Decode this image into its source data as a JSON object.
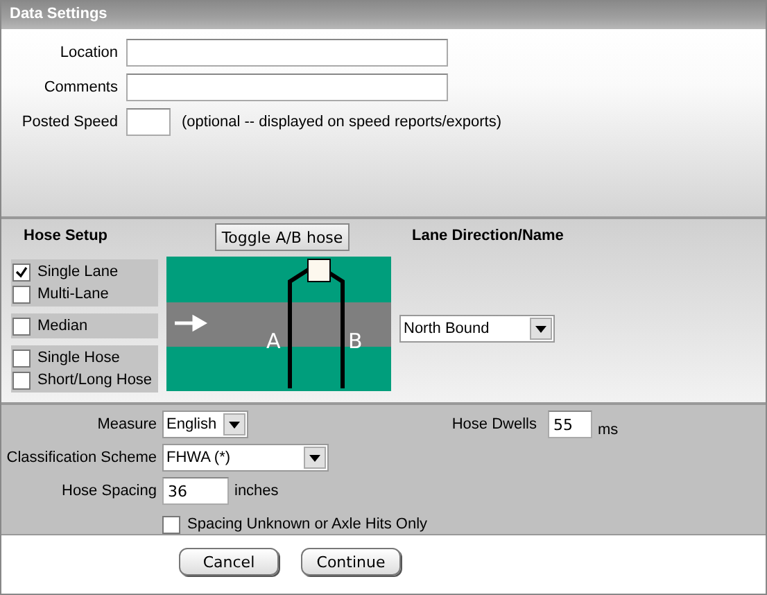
{
  "window": {
    "title": "Data Settings"
  },
  "fields": [
    {
      "label": "Location",
      "kind": "wide"
    },
    {
      "label": "Comments",
      "kind": "wide"
    },
    {
      "label": "Posted Speed",
      "kind": "short",
      "note": "(optional -- displayed on speed reports/exports)"
    }
  ],
  "hose_setup": {
    "title": "Hose Setup",
    "toggle_button": "Toggle A/B hose",
    "lane_title": "Lane Direction/Name",
    "lane_direction": "North Bound",
    "option_groups": [
      [
        {
          "label": "Single Lane",
          "checked": true
        },
        {
          "label": "Multi-Lane",
          "checked": false
        }
      ],
      [
        {
          "label": "Median",
          "checked": false
        }
      ],
      [
        {
          "label": "Single Hose",
          "checked": false
        },
        {
          "label": "Short/Long Hose",
          "checked": false
        }
      ]
    ],
    "diagram": {
      "label_a": "A",
      "label_b": "B"
    }
  },
  "measure": {
    "label": "Measure",
    "value": "English"
  },
  "hose_dwells": {
    "label": "Hose Dwells",
    "value": "55",
    "unit": "ms"
  },
  "classification": {
    "label": "Classification Scheme",
    "value": "FHWA (*)"
  },
  "hose_spacing": {
    "label": "Hose Spacing",
    "value": "36",
    "unit": "inches"
  },
  "spacing_unknown": {
    "label": "Spacing Unknown or Axle Hits Only",
    "checked": false
  },
  "buttons": [
    "Cancel",
    "Continue"
  ]
}
